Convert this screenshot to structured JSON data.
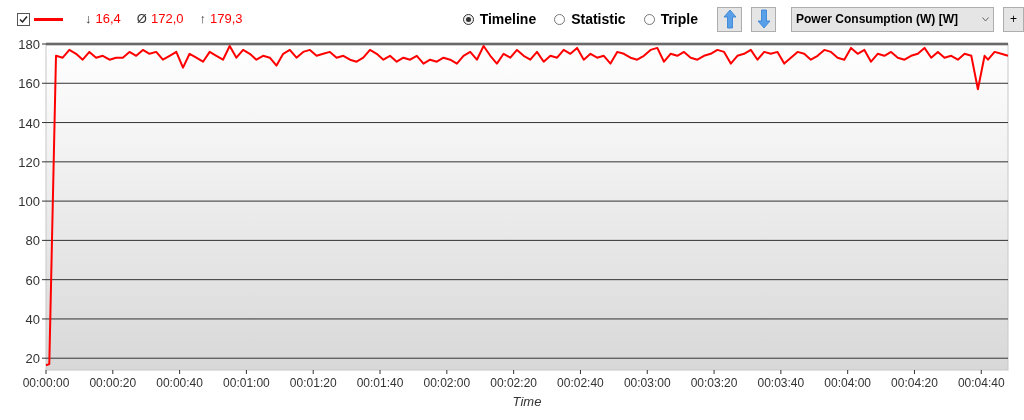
{
  "legend": {
    "checked": true,
    "color": "#ff0000",
    "stats": [
      {
        "symbol": "↓",
        "value": "16,4"
      },
      {
        "symbol": "Ø",
        "value": "172,0"
      },
      {
        "symbol": "↑",
        "value": "179,3"
      }
    ]
  },
  "views": [
    {
      "label": "Timeline",
      "selected": true
    },
    {
      "label": "Statistic",
      "selected": false
    },
    {
      "label": "Triple",
      "selected": false
    }
  ],
  "measure": {
    "value": "Power Consumption (W) [W]"
  },
  "add_button": "+",
  "chart": {
    "chart_data": {
      "type": "line",
      "grid": true,
      "xlabel": "Time",
      "xlim": [
        0,
        288
      ],
      "ylim": [
        14,
        180
      ],
      "xticks": [
        {
          "value": 0,
          "label": "00:00:00"
        },
        {
          "value": 20,
          "label": "00:00:20"
        },
        {
          "value": 40,
          "label": "00:00:40"
        },
        {
          "value": 60,
          "label": "00:01:00"
        },
        {
          "value": 80,
          "label": "00:01:20"
        },
        {
          "value": 100,
          "label": "00:01:40"
        },
        {
          "value": 120,
          "label": "00:02:00"
        },
        {
          "value": 140,
          "label": "00:02:20"
        },
        {
          "value": 160,
          "label": "00:02:40"
        },
        {
          "value": 180,
          "label": "00:03:00"
        },
        {
          "value": 200,
          "label": "00:03:20"
        },
        {
          "value": 220,
          "label": "00:03:40"
        },
        {
          "value": 240,
          "label": "00:04:00"
        },
        {
          "value": 260,
          "label": "00:04:20"
        },
        {
          "value": 280,
          "label": "00:04:40"
        }
      ],
      "yticks": [
        20,
        40,
        60,
        80,
        100,
        120,
        140,
        160,
        180
      ],
      "x": [
        0,
        1,
        3,
        5,
        7,
        9,
        11,
        13,
        15,
        17,
        19,
        21,
        23,
        25,
        27,
        29,
        31,
        33,
        35,
        37,
        39,
        41,
        43,
        45,
        47,
        49,
        51,
        53,
        55,
        57,
        59,
        61,
        63,
        65,
        67,
        69,
        71,
        73,
        75,
        77,
        79,
        81,
        83,
        85,
        87,
        89,
        91,
        93,
        95,
        97,
        99,
        101,
        103,
        105,
        107,
        109,
        111,
        113,
        115,
        117,
        119,
        121,
        123,
        125,
        127,
        129,
        131,
        133,
        135,
        137,
        139,
        141,
        143,
        145,
        147,
        149,
        151,
        153,
        155,
        157,
        159,
        161,
        163,
        165,
        167,
        169,
        171,
        173,
        175,
        177,
        179,
        181,
        183,
        185,
        187,
        189,
        191,
        193,
        195,
        197,
        199,
        201,
        203,
        205,
        207,
        209,
        211,
        213,
        215,
        217,
        219,
        221,
        223,
        225,
        227,
        229,
        231,
        233,
        235,
        237,
        239,
        241,
        243,
        245,
        247,
        249,
        251,
        253,
        255,
        257,
        259,
        261,
        263,
        265,
        267,
        269,
        271,
        273,
        275,
        277,
        279,
        281,
        282,
        284,
        286,
        288
      ],
      "series": [
        {
          "color": "#ff0000",
          "values": [
            16.4,
            17,
            174,
            173,
            177,
            175,
            172,
            176,
            173,
            174,
            172,
            173,
            173,
            176,
            174,
            177,
            175,
            176,
            172,
            174,
            176,
            168,
            175,
            173,
            171,
            176,
            174,
            172,
            179,
            173,
            177,
            175,
            172,
            174,
            173,
            169,
            175,
            177,
            173,
            176,
            177,
            174,
            175,
            176,
            173,
            174,
            172,
            171,
            173,
            177,
            175,
            172,
            174,
            171,
            173,
            172,
            174,
            170,
            172,
            171,
            173,
            172,
            170,
            174,
            176,
            172,
            179,
            174,
            170,
            175,
            173,
            177,
            174,
            172,
            176,
            171,
            174,
            173,
            177,
            175,
            178,
            172,
            175,
            173,
            174,
            170,
            176,
            175,
            173,
            172,
            174,
            177,
            178,
            171,
            175,
            174,
            176,
            173,
            172,
            174,
            175,
            177,
            176,
            170,
            174,
            175,
            177,
            172,
            176,
            175,
            176,
            170,
            173,
            176,
            175,
            172,
            174,
            177,
            176,
            173,
            172,
            178,
            175,
            177,
            171,
            175,
            174,
            176,
            173,
            172,
            174,
            175,
            178,
            173,
            176,
            173,
            174,
            172,
            175,
            174,
            157,
            174,
            172,
            176,
            175,
            174
          ]
        }
      ]
    }
  }
}
